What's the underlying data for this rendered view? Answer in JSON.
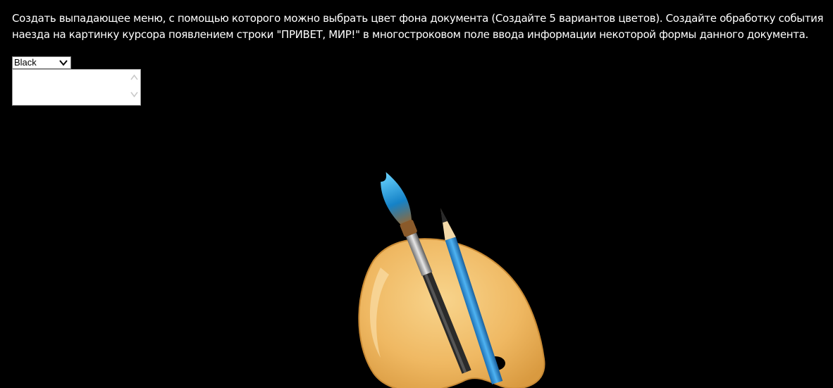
{
  "task": {
    "text": "Создать выпадающее меню, с помощью которого можно выбрать цвет фона документа (Создайте 5 вариантов цветов). Создайте обработку события наезда на картинку курсора появлением строки \"ПРИВЕТ, МИР!\" в многостроковом поле ввода информации некоторой формы данного документа."
  },
  "color_select": {
    "selected": "Black",
    "icon": "chevron-down-icon"
  },
  "output": {
    "value": ""
  },
  "image": {
    "subject": "palette-with-brush-and-pencil",
    "colors": {
      "palette": "#f2c26e",
      "brush_tip": "#1e9fe0",
      "pencil": "#2a8fd6",
      "background": "#000000"
    }
  }
}
